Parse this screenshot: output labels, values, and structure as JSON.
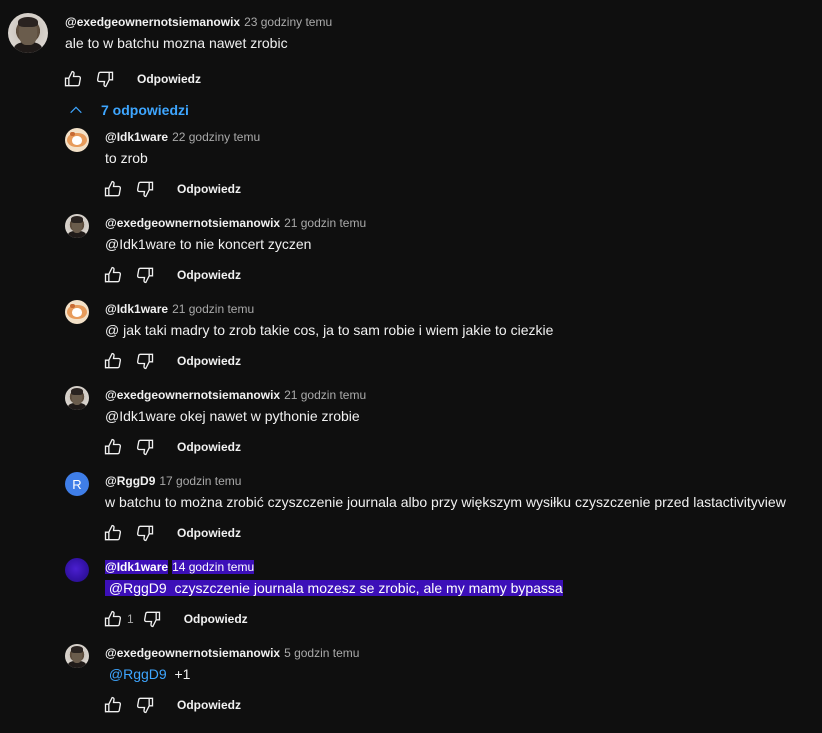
{
  "ui": {
    "reply_label": "Odpowiedz",
    "replies_toggle": "7 odpowiedzi"
  },
  "colors": {
    "background": "#0f0f0f",
    "link_blue": "#3ea6ff",
    "highlight_purple": "#3c0fb8",
    "meta_gray": "#aaaaaa"
  },
  "comment": {
    "author": "@exedgeownernotsiemanowix",
    "time": "23 godziny temu",
    "text": "ale to w batchu mozna nawet zrobic"
  },
  "replies": [
    {
      "author": "@Idk1ware",
      "time": "22 godziny temu",
      "text": "to zrob"
    },
    {
      "author": "@exedgeownernotsiemanowix",
      "time": "21 godzin temu",
      "text": "@Idk1ware to nie koncert zyczen"
    },
    {
      "author": "@Idk1ware",
      "time": "21 godzin temu",
      "text": "@ jak taki madry to zrob takie cos, ja to sam robie i wiem jakie to ciezkie"
    },
    {
      "author": "@exedgeownernotsiemanowix",
      "time": "21 godzin temu",
      "text": "@Idk1ware okej nawet w pythonie zrobie"
    },
    {
      "author": "@RggD9",
      "time": "17 godzin temu",
      "text": "w batchu to można zrobić czyszczenie journala albo przy większym wysiłku czyszczenie przed lastactivityview",
      "avatar_letter": "R"
    },
    {
      "author": "@Idk1ware",
      "time": "14 godzin temu",
      "mention": "@RggD9",
      "text": "czyszczenie journala mozesz se zrobic, ale my mamy bypassa",
      "likes": "1"
    },
    {
      "author": "@exedgeownernotsiemanowix",
      "time": "5 godzin temu",
      "mention": "@RggD9",
      "text": "+1"
    }
  ]
}
